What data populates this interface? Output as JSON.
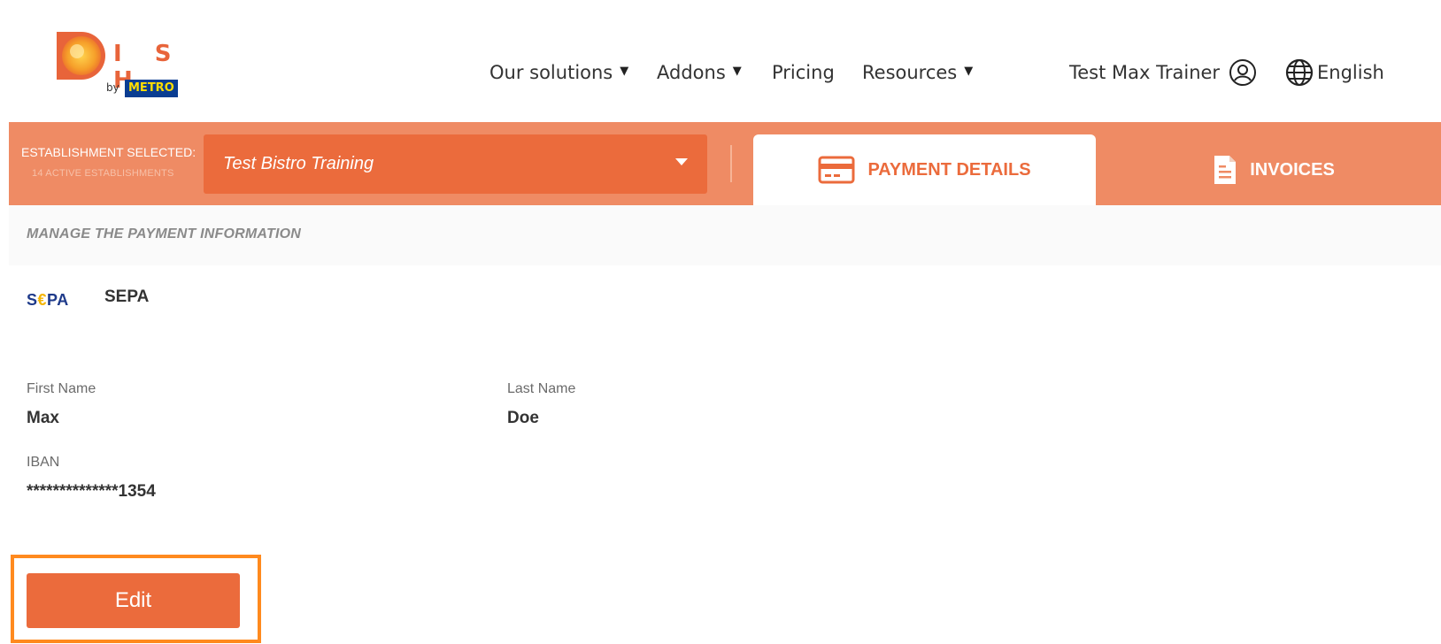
{
  "brand": {
    "logo_letters": "I S H",
    "logo_by": "by",
    "logo_metro": "METRO"
  },
  "nav": {
    "solutions": "Our solutions",
    "addons": "Addons",
    "pricing": "Pricing",
    "resources": "Resources"
  },
  "user": {
    "name": "Test Max Trainer"
  },
  "language": {
    "label": "English"
  },
  "establishment": {
    "label": "ESTABLISHMENT SELECTED:",
    "count": "14 ACTIVE ESTABLISHMENTS",
    "selected": "Test Bistro Training"
  },
  "tabs": [
    {
      "label": "PAYMENT DETAILS",
      "active": true
    },
    {
      "label": "INVOICES",
      "active": false
    }
  ],
  "payment": {
    "section_title": "MANAGE THE PAYMENT INFORMATION",
    "method_logo": "S€PA",
    "method_name": "SEPA",
    "first_name_label": "First Name",
    "first_name": "Max",
    "last_name_label": "Last Name",
    "last_name": "Doe",
    "iban_label": "IBAN",
    "iban": "**************1354",
    "edit_label": "Edit"
  },
  "colors": {
    "brand_orange": "#eb6b3c",
    "bar_orange": "#ef8b64",
    "highlight": "#ff8a1e"
  }
}
